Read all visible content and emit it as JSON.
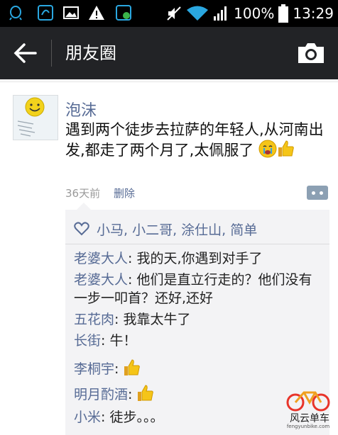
{
  "status_bar": {
    "battery_percent": "100%",
    "time": "13:29",
    "icons": [
      "qq-icon",
      "app-icon",
      "image-icon",
      "warning-icon",
      "app-update-icon",
      "mute-icon",
      "wifi-icon",
      "signal-icon",
      "battery-icon"
    ]
  },
  "app_bar": {
    "title": "朋友圈",
    "back_icon": "back-arrow-icon",
    "camera_icon": "camera-icon",
    "background": "#222326"
  },
  "post": {
    "author": "泡沫",
    "text": "遇到两个徒步去拉萨的年轻人,从河南出发,都走了两个月了,太佩服了",
    "emojis": [
      "crying-emoji",
      "thumbs-up-emoji"
    ],
    "time": "36天前",
    "delete_label": "删除",
    "more_icon": "more-icon"
  },
  "likes": {
    "names": "小马, 小二哥, 涂仕山, 简单"
  },
  "comments": [
    {
      "name": "老婆大人",
      "text": "我的天,你遇到对手了",
      "emoji": ""
    },
    {
      "name": "老婆大人",
      "text": "他们是直立行走的？他们没有一步一叩首？还好,还好",
      "emoji": ""
    },
    {
      "name": "五花肉",
      "text": "我靠太牛了",
      "emoji": ""
    },
    {
      "name": "长街",
      "text": "牛！",
      "emoji": ""
    },
    {
      "name": "李桐宇",
      "text": "",
      "emoji": "thumbs-up-emoji"
    },
    {
      "name": "明月酌酒",
      "text": "",
      "emoji": "thumbs-up-emoji"
    },
    {
      "name": "小米",
      "text": "徒步。。。",
      "emoji": ""
    }
  ],
  "watermark": {
    "text": "风云单车",
    "url": "fengyunbike.com"
  },
  "colors": {
    "link_blue": "#576b95",
    "comment_bg": "#f3f3f5"
  }
}
